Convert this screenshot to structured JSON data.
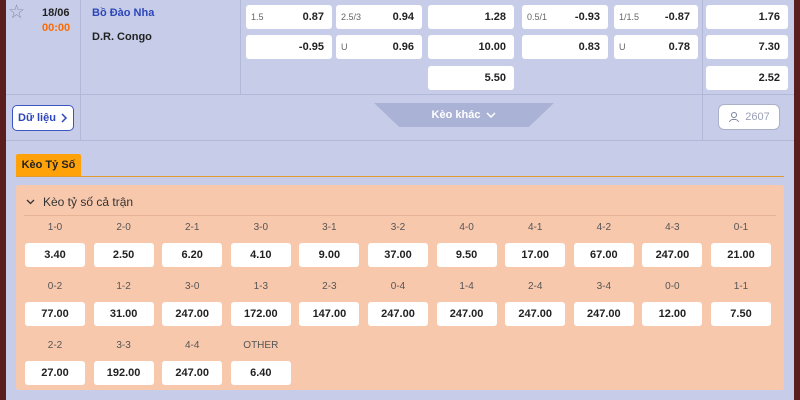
{
  "match": {
    "date": "18/06",
    "time": "00:00",
    "team_home": "Bồ Đào Nha",
    "team_away": "D.R. Congo",
    "odds": [
      {
        "handicap": "1.5",
        "value": "0.87"
      },
      {
        "handicap": "2.5/3",
        "value": "0.94"
      },
      {
        "handicap": "",
        "value": "1.28"
      },
      {
        "handicap": "0.5/1",
        "value": "-0.93"
      },
      {
        "handicap": "1/1.5",
        "value": "-0.87"
      },
      {
        "handicap": "",
        "value": "1.76"
      },
      {
        "handicap": "",
        "value": "-0.95"
      },
      {
        "handicap": "U",
        "value": "0.96"
      },
      {
        "handicap": "",
        "value": "10.00"
      },
      {
        "handicap": "",
        "value": "0.83"
      },
      {
        "handicap": "U",
        "value": "0.78"
      },
      {
        "handicap": "",
        "value": "7.30"
      },
      {
        "handicap": "",
        "value": "5.50"
      },
      {
        "handicap": "",
        "value": "2.52"
      }
    ]
  },
  "actions": {
    "data_label": "Dữ liệu",
    "more_label": "Kèo khác",
    "viewer_count": "2607"
  },
  "section": {
    "tab_label": "Kèo Tỷ Số",
    "panel_title": "Kèo tỷ số cả trận",
    "scores": [
      {
        "label": "1-0",
        "odd": "3.40"
      },
      {
        "label": "2-0",
        "odd": "2.50"
      },
      {
        "label": "2-1",
        "odd": "6.20"
      },
      {
        "label": "3-0",
        "odd": "4.10"
      },
      {
        "label": "3-1",
        "odd": "9.00"
      },
      {
        "label": "3-2",
        "odd": "37.00"
      },
      {
        "label": "4-0",
        "odd": "9.50"
      },
      {
        "label": "4-1",
        "odd": "17.00"
      },
      {
        "label": "4-2",
        "odd": "67.00"
      },
      {
        "label": "4-3",
        "odd": "247.00"
      },
      {
        "label": "0-1",
        "odd": "21.00"
      },
      {
        "label": "0-2",
        "odd": "77.00"
      },
      {
        "label": "1-2",
        "odd": "31.00"
      },
      {
        "label": "3-0",
        "odd": "247.00"
      },
      {
        "label": "1-3",
        "odd": "172.00"
      },
      {
        "label": "2-3",
        "odd": "147.00"
      },
      {
        "label": "0-4",
        "odd": "247.00"
      },
      {
        "label": "1-4",
        "odd": "247.00"
      },
      {
        "label": "2-4",
        "odd": "247.00"
      },
      {
        "label": "3-4",
        "odd": "247.00"
      },
      {
        "label": "0-0",
        "odd": "12.00"
      },
      {
        "label": "1-1",
        "odd": "7.50"
      },
      {
        "label": "2-2",
        "odd": "27.00"
      },
      {
        "label": "3-3",
        "odd": "192.00"
      },
      {
        "label": "4-4",
        "odd": "247.00"
      },
      {
        "label": "OTHER",
        "odd": "6.40"
      }
    ]
  },
  "icons": {
    "favorite": "star-icon",
    "data_chevron": "chevron-right-icon",
    "more_chevron": "chevron-down-icon",
    "viewers": "user-icon",
    "panel_toggle": "chevron-down-icon"
  },
  "colors": {
    "background": "#c7cde9",
    "accent_orange": "#ffa20a",
    "time_orange": "#ff6a00",
    "team_blue": "#2d45b8",
    "panel_bg": "#f8c8ad"
  }
}
